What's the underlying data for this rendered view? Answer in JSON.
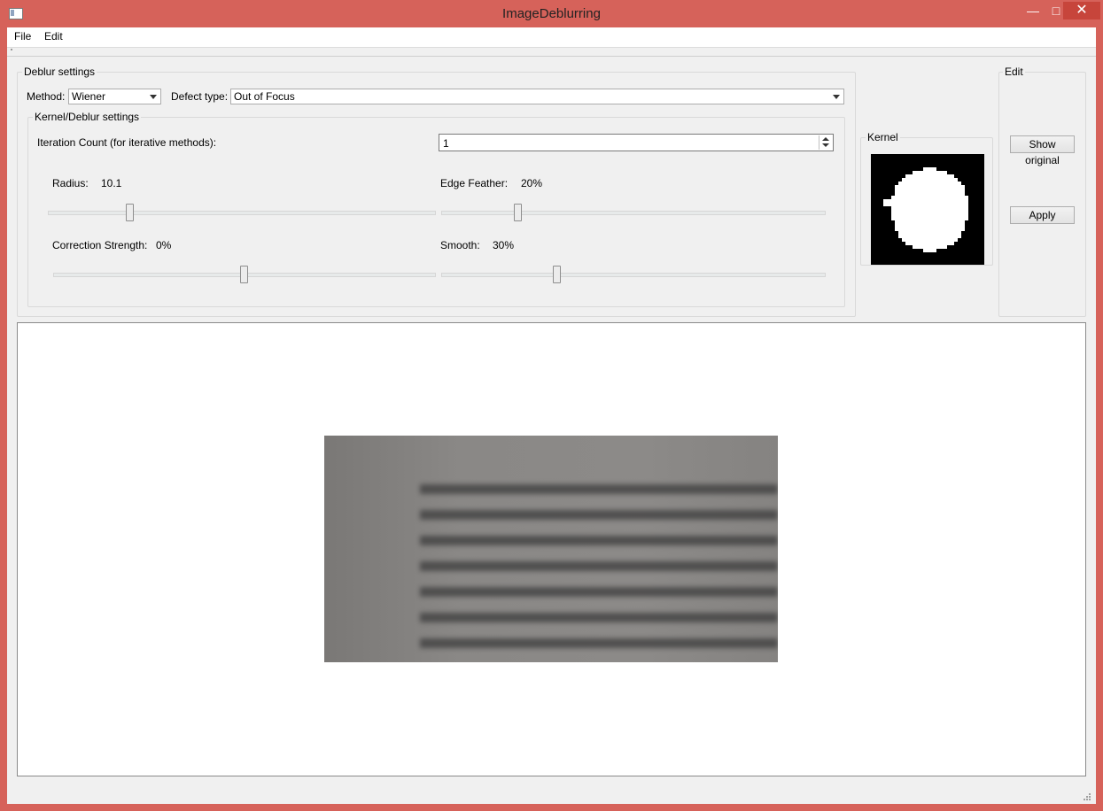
{
  "window": {
    "title": "ImageDeblurring"
  },
  "menu": {
    "file": "File",
    "edit": "Edit"
  },
  "deblur": {
    "group_title": "Deblur settings",
    "method_label": "Method:",
    "method_value": "Wiener",
    "defect_label": "Defect type:",
    "defect_value": "Out of Focus"
  },
  "kernel_settings": {
    "group_title": "Kernel/Deblur settings",
    "iteration_label": "Iteration Count (for iterative methods):",
    "iteration_value": "1",
    "radius_label": "Radius:",
    "radius_value": "10.1",
    "edge_label": "Edge Feather:",
    "edge_value": "20%",
    "correction_label": "Correction Strength:",
    "correction_value": "0%",
    "smooth_label": "Smooth:",
    "smooth_value": "30%"
  },
  "sliders": {
    "radius_fraction": 0.21,
    "edge_fraction": 0.2,
    "correction_fraction": 0.5,
    "smooth_fraction": 0.3
  },
  "kernel": {
    "group_title": "Kernel"
  },
  "edit": {
    "group_title": "Edit",
    "show_original": "Show original",
    "apply": "Apply"
  },
  "colors": {
    "titlebar": "#d6625a",
    "close_button": "#c7453b",
    "window_bg": "#f0f0f0"
  }
}
